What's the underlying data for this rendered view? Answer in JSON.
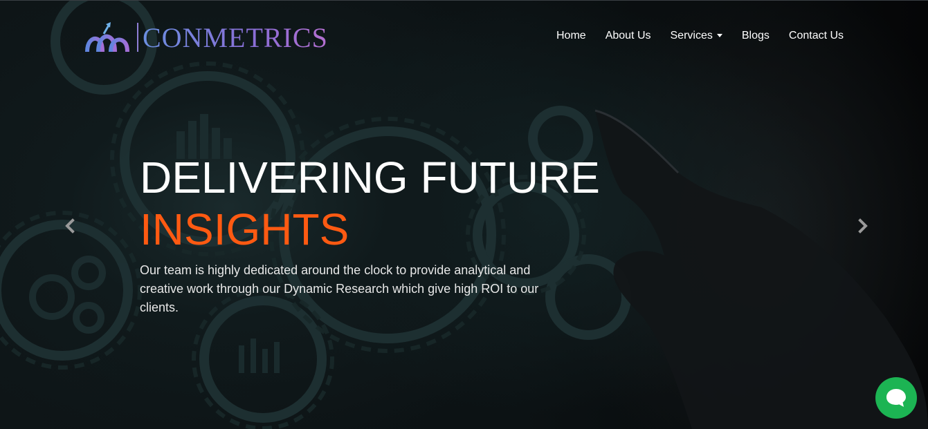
{
  "brand": {
    "name": "CONMETRICS",
    "logo_icon": "conmetrics-logo-icon"
  },
  "nav": {
    "items": [
      {
        "label": "Home"
      },
      {
        "label": "About Us"
      },
      {
        "label": "Services",
        "has_dropdown": true
      },
      {
        "label": "Blogs"
      },
      {
        "label": "Contact Us"
      }
    ]
  },
  "hero": {
    "title_line1": "DELIVERING FUTURE",
    "title_line2": "INSIGHTS",
    "subtitle": "Our team is highly dedicated around the clock to provide analytical and creative work through our Dynamic Research which give high ROI to our clients.",
    "prev_icon": "chevron-left-icon",
    "next_icon": "chevron-right-icon"
  },
  "chat": {
    "icon": "chat-bubble-icon"
  },
  "colors": {
    "accent_orange": "#ff5a12",
    "chat_green": "#1cb453",
    "logo_purple": "#8a6ed6",
    "text_white": "#ffffff"
  }
}
